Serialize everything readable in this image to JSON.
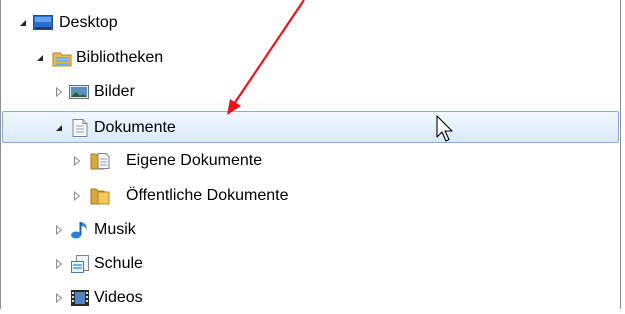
{
  "tree": {
    "items": [
      {
        "label": "Desktop",
        "icon": "desktop-icon",
        "expanded": true
      },
      {
        "label": "Bibliotheken",
        "icon": "libraries-icon",
        "expanded": true
      },
      {
        "label": "Bilder",
        "icon": "pictures-library-icon",
        "expanded": false
      },
      {
        "label": "Dokumente",
        "icon": "documents-library-icon",
        "expanded": true,
        "selected": true
      },
      {
        "label": "Eigene Dokumente",
        "icon": "document-folder-icon",
        "expanded": false
      },
      {
        "label": "Öffentliche Dokumente",
        "icon": "folder-icon",
        "expanded": false
      },
      {
        "label": "Musik",
        "icon": "music-library-icon",
        "expanded": false
      },
      {
        "label": "Schule",
        "icon": "custom-library-icon",
        "expanded": false
      },
      {
        "label": "Videos",
        "icon": "videos-library-icon",
        "expanded": false
      }
    ]
  },
  "colors": {
    "selection_border": "#84acdd",
    "selection_fill": "#d9eafc",
    "annotation_arrow": "#e8141c"
  }
}
